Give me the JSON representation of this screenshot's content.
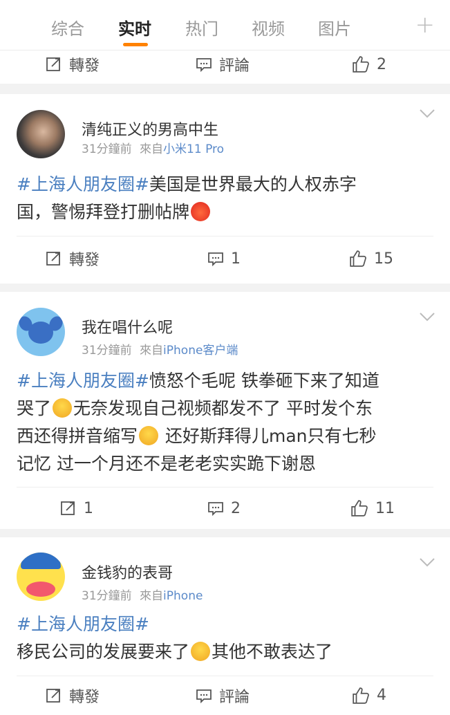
{
  "tabs": [
    "综合",
    "实时",
    "热门",
    "视频",
    "图片"
  ],
  "top_actions": {
    "repost": "轉發",
    "comment": "評論",
    "like": "2"
  },
  "posts": [
    {
      "user": "清纯正义的男高中生",
      "time": "31分鐘前",
      "from": "來自",
      "source": "小米11 Pro",
      "tag": "#上海人朋友圈#",
      "text1": "美国是世界最大的人权赤字",
      "text2": "国，警惕拜登打删帖牌",
      "emoji": "angry-face",
      "actions": {
        "repost": "轉發",
        "comment": "1",
        "like": "15"
      }
    },
    {
      "user": "我在唱什么呢",
      "time": "31分鐘前",
      "from": "來自",
      "source": "iPhone客户端",
      "tag": "#上海人朋友圈#",
      "line1": "愤怒个毛呢 铁拳砸下来了知道",
      "line2a": "哭了",
      "line2b": "无奈发现自己视频都发不了 平时发个东",
      "line3a": "西还得拼音缩写",
      "line3b": " 还好斯拜得儿man只有七秒",
      "line4": "记忆 过一个月还不是老老实实跪下谢恩",
      "emoji": "laugh-cry-face",
      "actions": {
        "repost": "1",
        "comment": "2",
        "like": "11"
      }
    },
    {
      "user": "金钱豹的表哥",
      "time": "31分鐘前",
      "from": "來自",
      "source": "iPhone",
      "tag": "#上海人朋友圈#",
      "line1": "移民公司的发展要来了",
      "line1b": "其他不敢表达了",
      "emoji": "hush-face",
      "actions": {
        "repost": "轉發",
        "comment": "評論",
        "like": "4"
      }
    }
  ]
}
